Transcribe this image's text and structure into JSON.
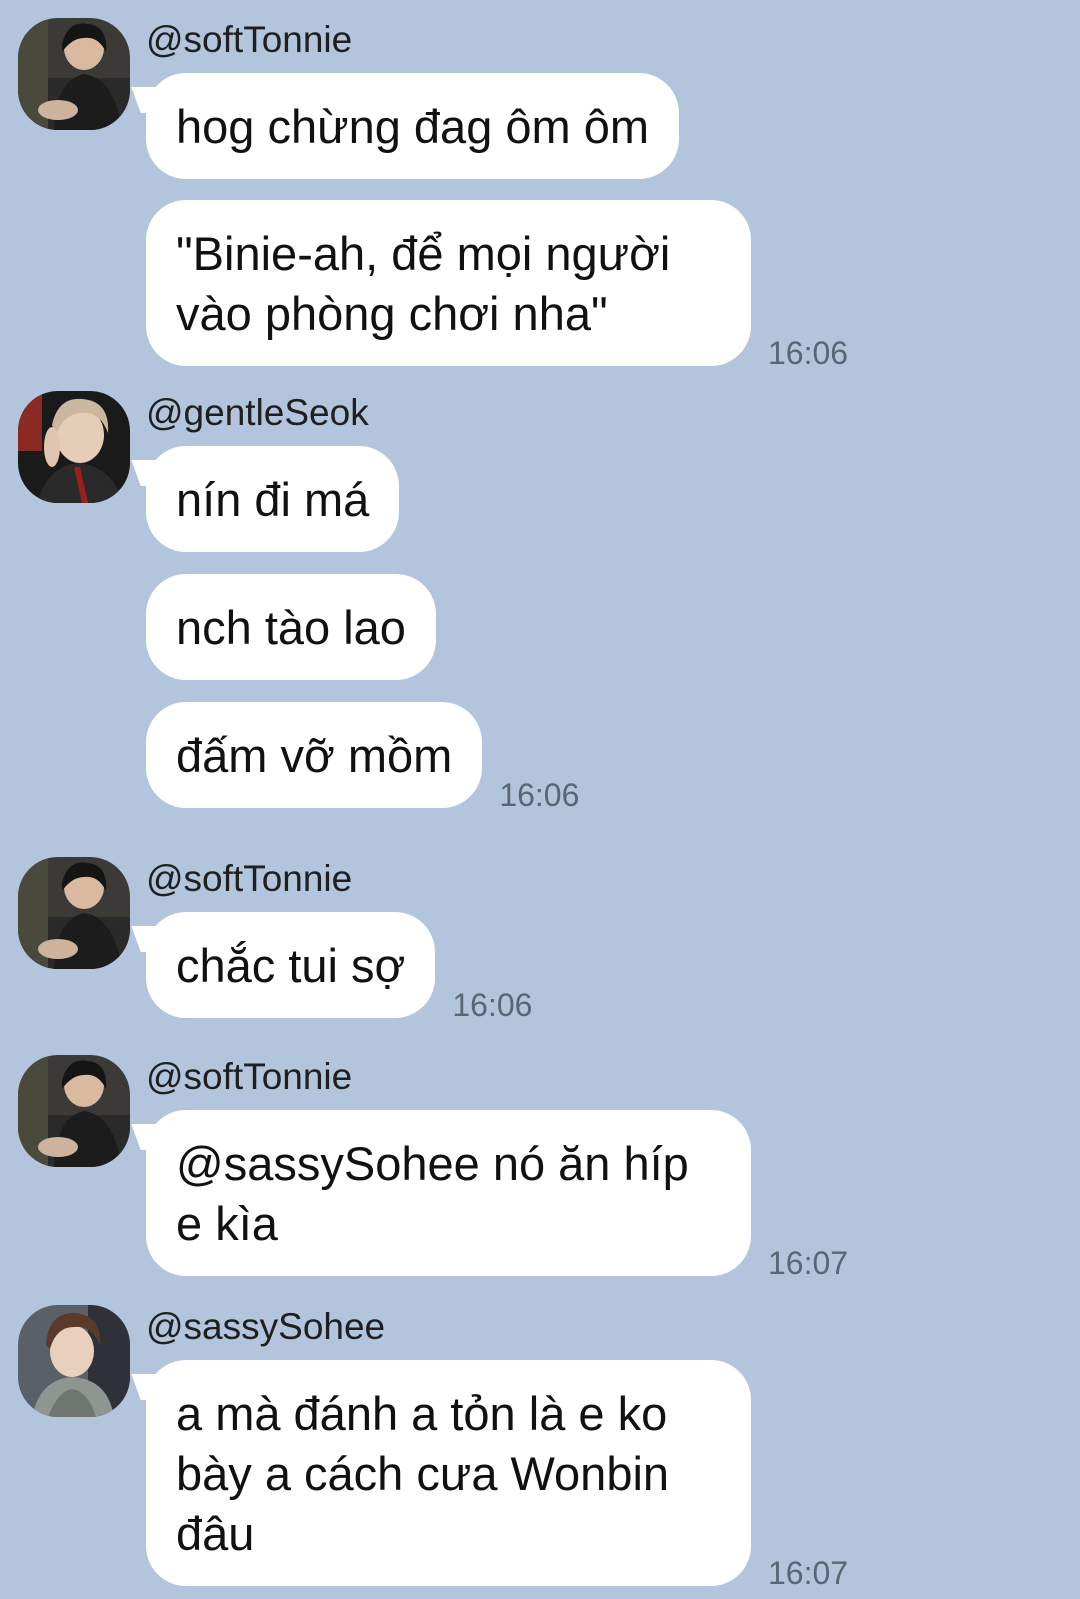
{
  "groups": [
    {
      "username": "@softTonnie",
      "avatar": "avatar-softtonnie",
      "messages": [
        {
          "text": "hog chừng đag ôm ôm",
          "time": ""
        },
        {
          "text": "\"Binie-ah, để mọi người vào phòng chơi nha\"",
          "time": "16:06"
        }
      ]
    },
    {
      "username": "@gentleSeok",
      "avatar": "avatar-gentleseok",
      "messages": [
        {
          "text": "nín đi má",
          "time": ""
        },
        {
          "text": "nch tào lao",
          "time": ""
        },
        {
          "text": "đấm vỡ mồm",
          "time": "16:06"
        }
      ]
    },
    {
      "username": "@softTonnie",
      "avatar": "avatar-softtonnie",
      "messages": [
        {
          "text": "chắc tui sợ",
          "time": "16:06"
        }
      ]
    },
    {
      "username": "@softTonnie",
      "avatar": "avatar-softtonnie",
      "messages": [
        {
          "text": "@sassySohee nó ăn híp e kìa",
          "time": "16:07"
        }
      ]
    },
    {
      "username": "@sassySohee",
      "avatar": "avatar-sassysohee",
      "messages": [
        {
          "text": "a mà đánh a tỏn là e ko bày a cách cưa Wonbin đâu",
          "time": "16:07"
        }
      ]
    }
  ],
  "colors": {
    "background": "#b2c5dd",
    "bubble": "#ffffff",
    "time": "#5b6675"
  }
}
